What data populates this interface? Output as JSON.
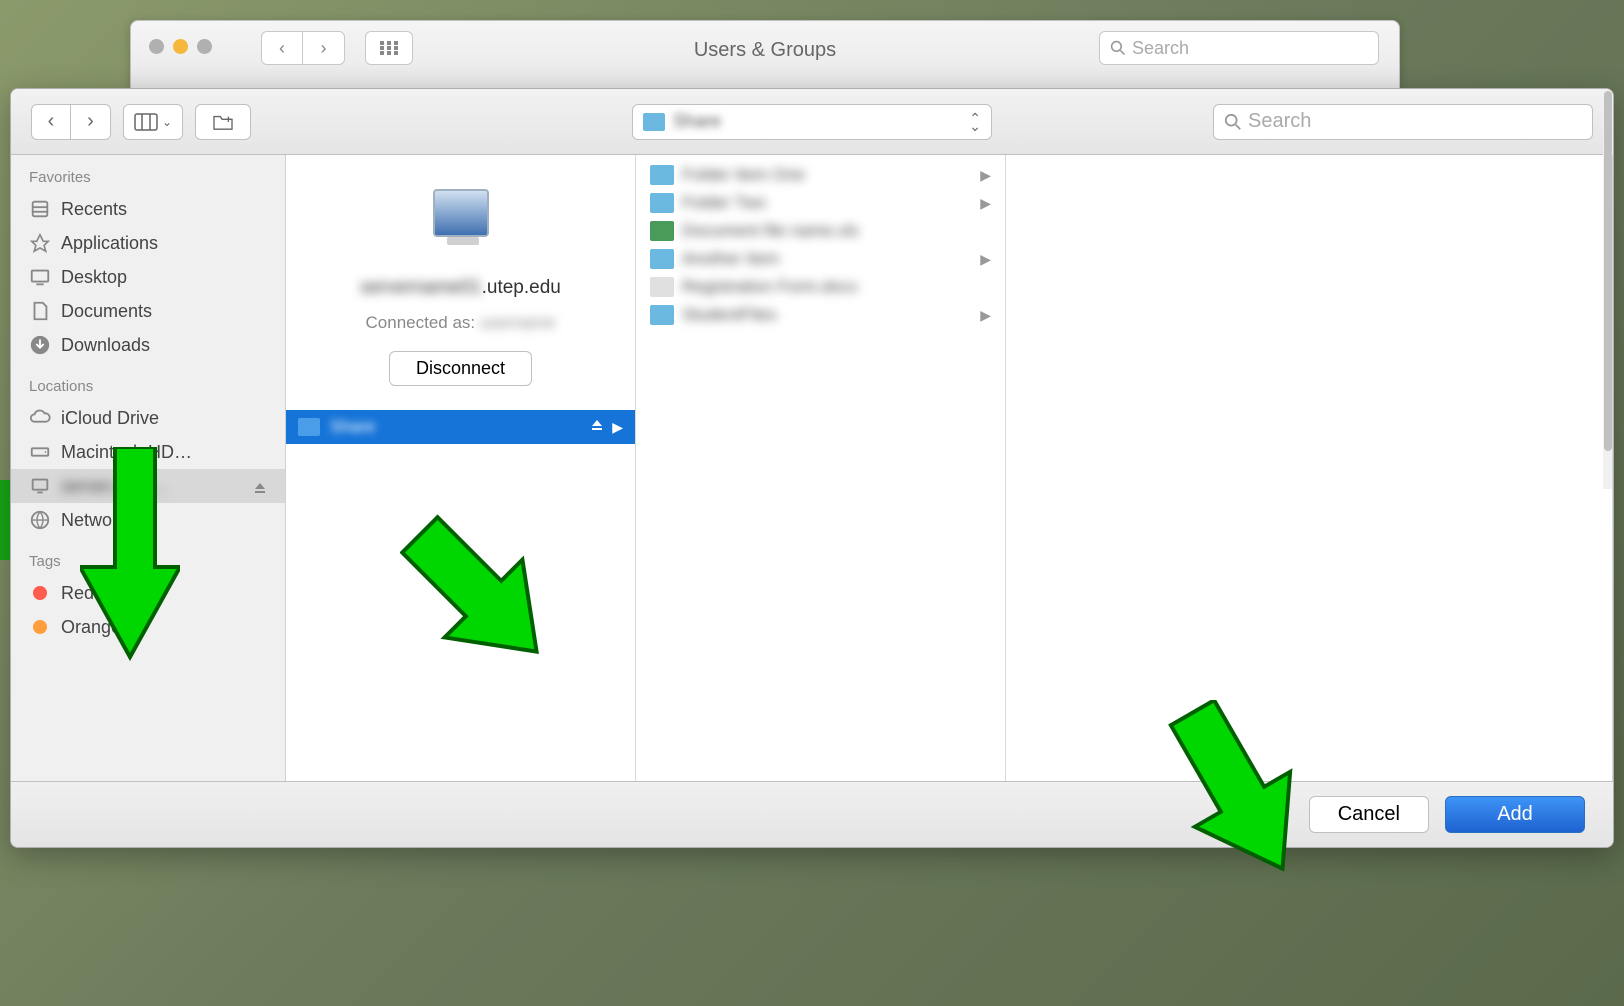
{
  "bg_window": {
    "title": "Users & Groups",
    "search_placeholder": "Search"
  },
  "toolbar": {
    "path_label": "Share",
    "search_placeholder": "Search"
  },
  "sidebar": {
    "sections": [
      {
        "header": "Favorites",
        "items": [
          {
            "label": "Recents",
            "icon": "recents"
          },
          {
            "label": "Applications",
            "icon": "applications"
          },
          {
            "label": "Desktop",
            "icon": "desktop"
          },
          {
            "label": "Documents",
            "icon": "documents"
          },
          {
            "label": "Downloads",
            "icon": "downloads"
          }
        ]
      },
      {
        "header": "Locations",
        "items": [
          {
            "label": "iCloud Drive",
            "icon": "icloud"
          },
          {
            "label": "Macintosh HD…",
            "icon": "hd"
          },
          {
            "label": "server.utep…",
            "icon": "computer",
            "eject": true,
            "selected": true,
            "blurred": true
          },
          {
            "label": "Network",
            "icon": "network"
          }
        ]
      },
      {
        "header": "Tags",
        "items": [
          {
            "label": "Red",
            "tag": "red"
          },
          {
            "label": "Orange",
            "tag": "orange"
          }
        ]
      }
    ]
  },
  "server": {
    "hostname_prefix": "servername01",
    "hostname_suffix": ".utep.edu",
    "connected_prefix": "Connected as: ",
    "connected_user": "username",
    "disconnect_label": "Disconnect",
    "share_label": "Share"
  },
  "folder_column": [
    {
      "label": "Folder Item One",
      "type": "folder",
      "chevron": true
    },
    {
      "label": "Folder Two",
      "type": "folder",
      "chevron": true
    },
    {
      "label": "Document file name.xls",
      "type": "xls",
      "chevron": false
    },
    {
      "label": "Another Item",
      "type": "folder",
      "chevron": true
    },
    {
      "label": "Registration Form.docx",
      "type": "doc",
      "chevron": false
    },
    {
      "label": "StudentFiles",
      "type": "folder",
      "chevron": true
    }
  ],
  "buttons": {
    "cancel": "Cancel",
    "add": "Add"
  }
}
